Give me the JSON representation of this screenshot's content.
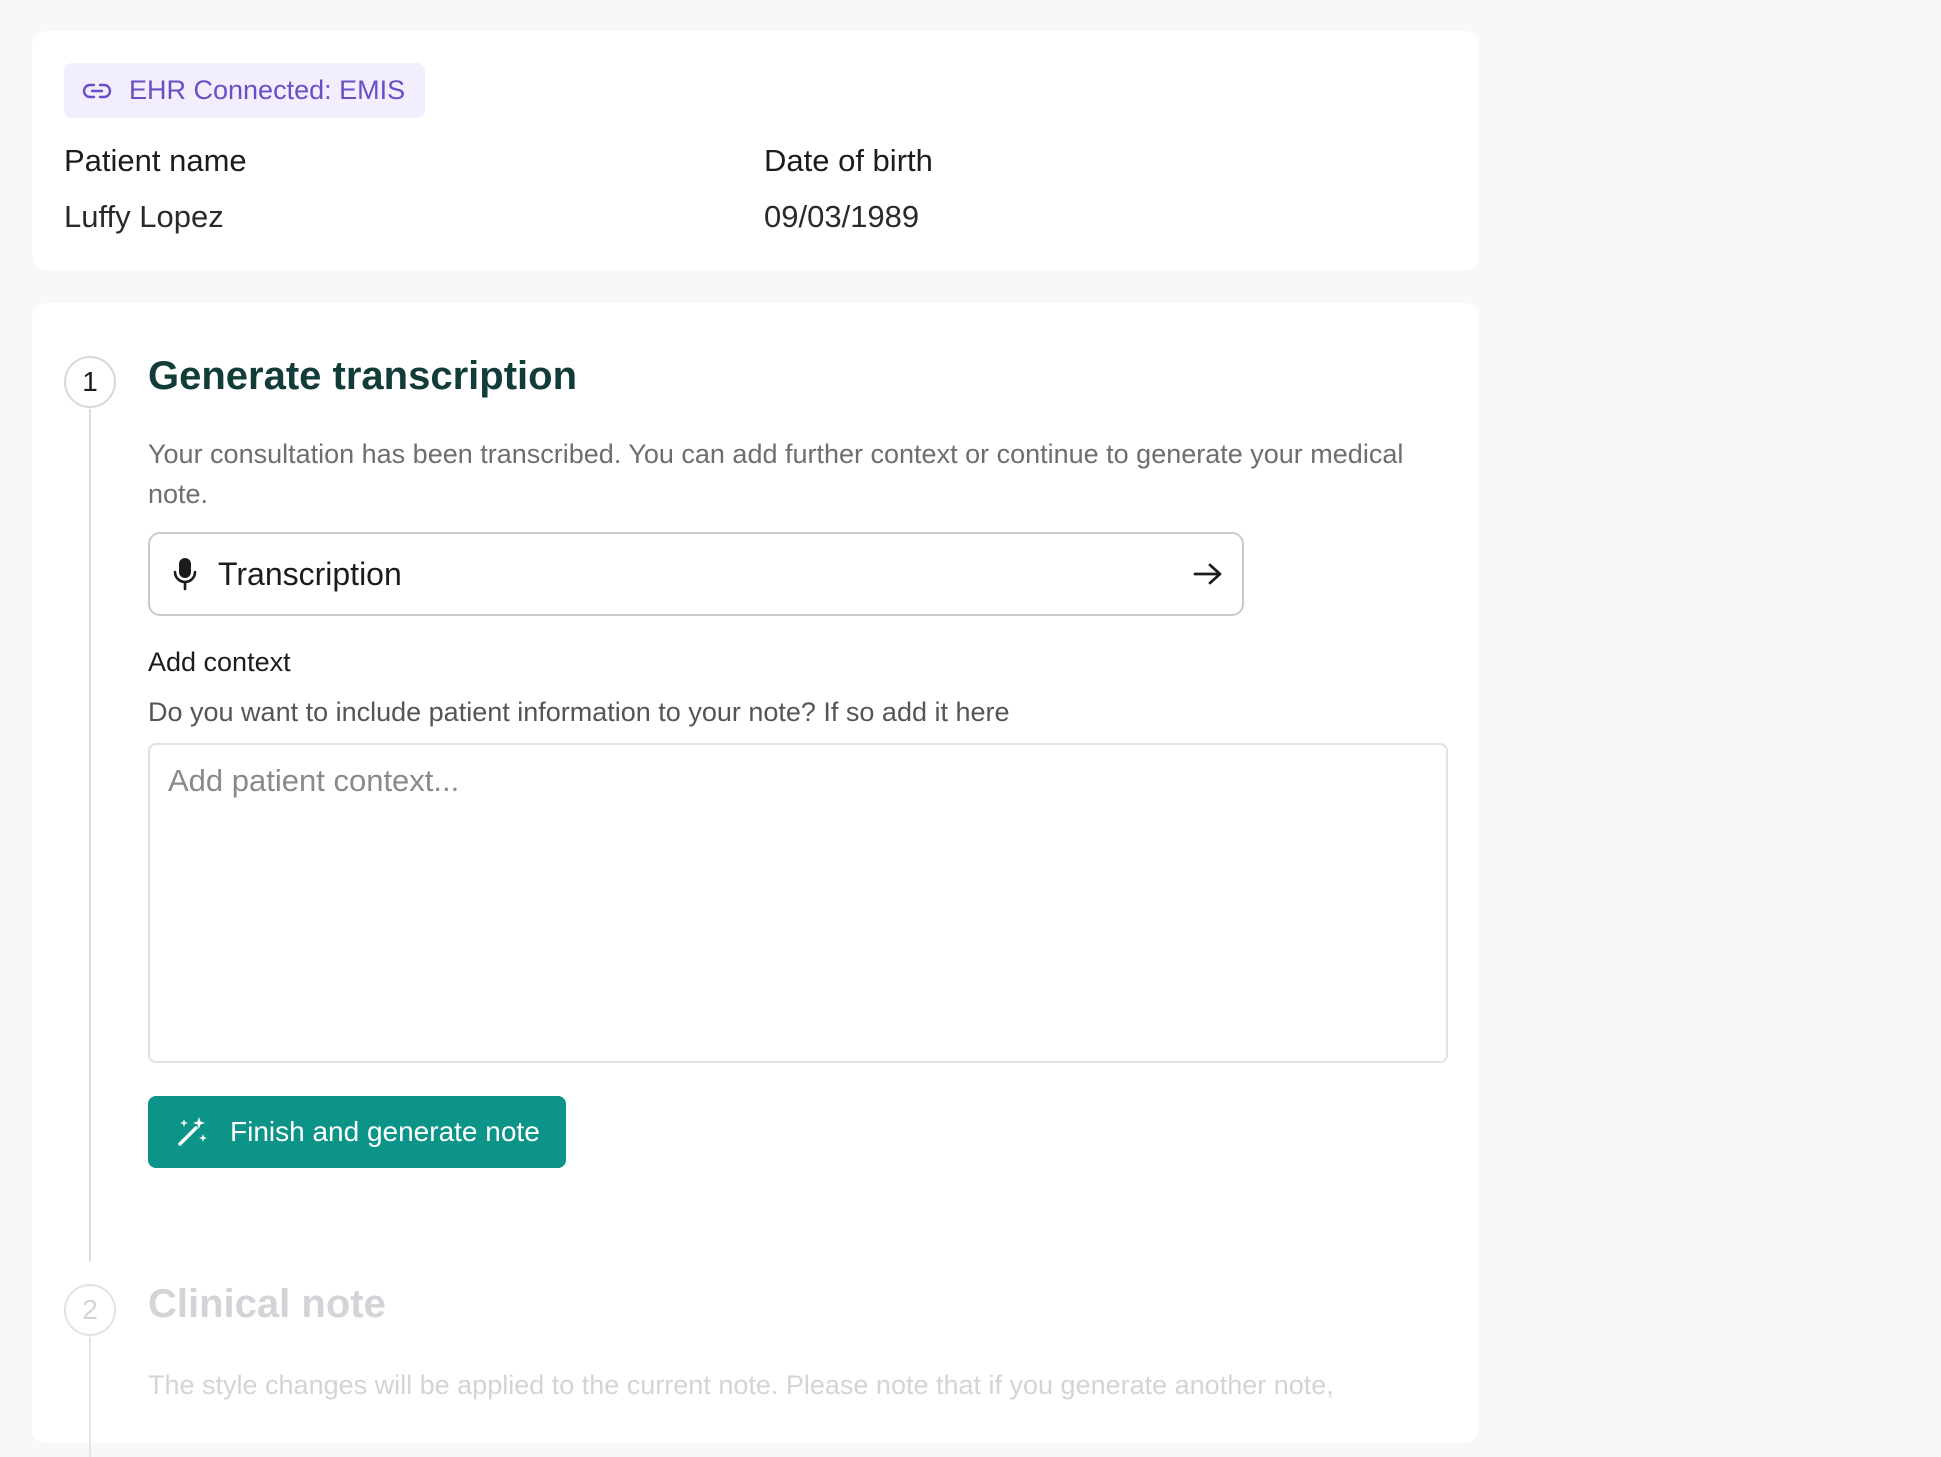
{
  "patient": {
    "ehr_badge": "EHR Connected: EMIS",
    "name_label": "Patient name",
    "name_value": "Luffy Lopez",
    "dob_label": "Date of birth",
    "dob_value": "09/03/1989"
  },
  "steps": [
    {
      "number": "1",
      "title": "Generate transcription",
      "description": "Your consultation has been transcribed. You can add further context or continue to generate your medical note.",
      "transcription_label": "Transcription",
      "context_label": "Add context",
      "context_help": "Do you want to include patient information to your note? If so add it here",
      "context_placeholder": "Add patient context...",
      "generate_button": "Finish and generate note"
    },
    {
      "number": "2",
      "title": "Clinical note",
      "description": "The style changes will be applied to the current note. Please note that if you generate another note,"
    }
  ],
  "colors": {
    "accent": "#0d9488",
    "step_title": "#123c3a",
    "disabled_text": "#d2d4d8",
    "badge_bg": "#f2eefe",
    "badge_text": "#6a4fc4"
  },
  "icons": {
    "ehr": "link-icon",
    "transcription": "microphone-icon",
    "transcription_action": "arrow-right-icon",
    "generate": "magic-wand-icon"
  }
}
